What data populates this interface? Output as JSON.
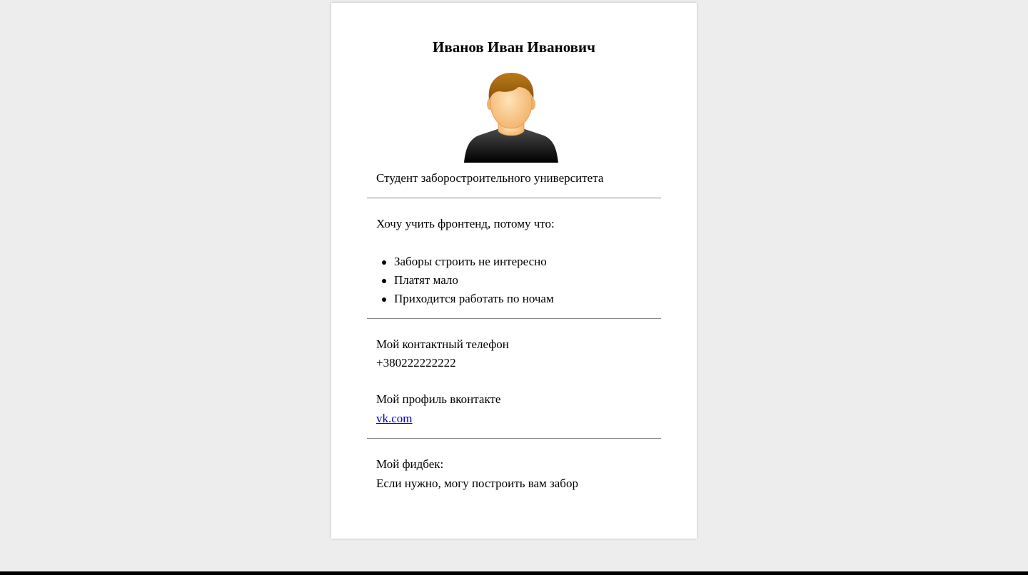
{
  "profile": {
    "name": "Иванов Иван Иванович",
    "description": "Студент заборостроительного университета"
  },
  "motivation": {
    "intro": "Хочу учить фронтенд, потому что:",
    "reasons": [
      "Заборы строить не интересно",
      "Платят мало",
      "Приходится работать по ночам"
    ]
  },
  "contacts": {
    "phone_label": "Мой контактный телефон",
    "phone": "+380222222222",
    "vk_label": "Мой профиль вконтакте",
    "vk_link": "vk.com"
  },
  "feedback": {
    "label": "Мой фидбек:",
    "text": "Если нужно, могу построить вам забор"
  },
  "colors": {
    "page_background": "#ededed",
    "card_background": "#ffffff",
    "link": "#0000cc",
    "divider": "#888888"
  },
  "icons": {
    "avatar": "user-avatar-icon"
  }
}
